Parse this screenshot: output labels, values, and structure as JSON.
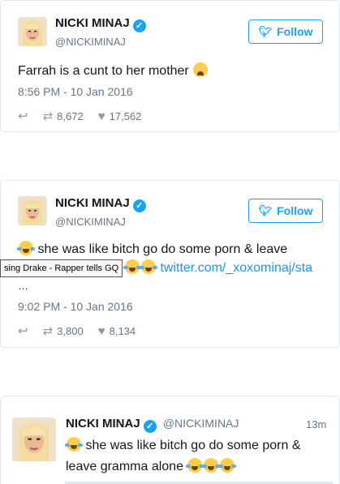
{
  "colors": {
    "accent": "#1da1f2",
    "text": "#14171a",
    "muted": "#657786",
    "link": "#1b95e0"
  },
  "tweets": [
    {
      "name": "NICKI MINAJ",
      "handle": "@NICKIMINAJ",
      "follow_label": "Follow",
      "text": "Farrah is a cunt to her mother",
      "emoji": "weary-face",
      "time": "8:56 PM - 10 Jan 2016",
      "retweets": "8,672",
      "likes": "17,562"
    },
    {
      "name": "NICKI MINAJ",
      "handle": "@NICKIMINAJ",
      "follow_label": "Follow",
      "line1": "she was like bitch go do some porn & leave",
      "link": "twitter.com/_xoxominaj/sta",
      "ellipsis": "…",
      "time": "9:02 PM - 10 Jan 2016",
      "retweets": "3,800",
      "likes": "8,134"
    },
    {
      "name": "NICKI MINAJ",
      "handle": "@NICKIMINAJ",
      "age": "13m",
      "line1": "she was like bitch go do some porn &",
      "line2": "leave gramma alone"
    }
  ],
  "tooltip": "sing Drake - Rapper tells GQ",
  "icons": [
    "twitter-bird-icon",
    "verified-badge-icon",
    "reply-icon",
    "retweet-icon",
    "heart-icon",
    "face-with-tears-of-joy-icon",
    "weary-face-icon"
  ]
}
